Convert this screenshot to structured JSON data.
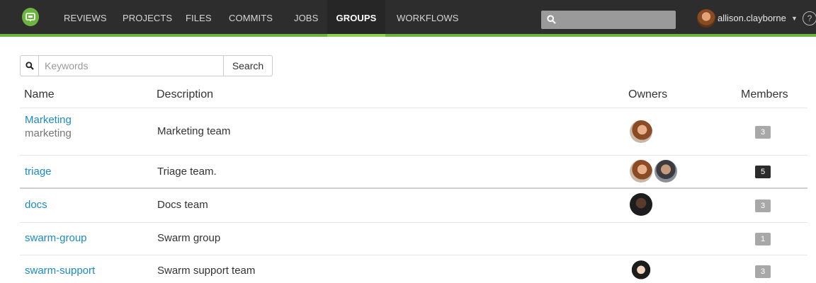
{
  "nav": {
    "items": [
      {
        "label": "REVIEWS",
        "active": false
      },
      {
        "label": "PROJECTS",
        "active": false
      },
      {
        "label": "FILES",
        "active": false
      },
      {
        "label": "COMMITS",
        "active": false
      },
      {
        "label": "JOBS",
        "active": false
      },
      {
        "label": "GROUPS",
        "active": true
      },
      {
        "label": "WORKFLOWS",
        "active": false
      }
    ],
    "user": "allison.clayborne",
    "help": "?"
  },
  "search": {
    "placeholder": "Keywords",
    "button_label": "Search"
  },
  "table": {
    "headers": {
      "name": "Name",
      "description": "Description",
      "owners": "Owners",
      "members": "Members"
    },
    "rows": [
      {
        "name": "Marketing",
        "id": "marketing",
        "description": "Marketing team",
        "owners": [
          "allison"
        ],
        "members": "3",
        "highlight": false
      },
      {
        "name": "triage",
        "id": "",
        "description": "Triage team.",
        "owners": [
          "allison",
          "man"
        ],
        "members": "5",
        "highlight": true
      },
      {
        "name": "docs",
        "id": "",
        "description": "Docs team",
        "owners": [
          "dark"
        ],
        "members": "3",
        "highlight": false
      },
      {
        "name": "swarm-group",
        "id": "",
        "description": "Swarm group",
        "owners": [],
        "members": "1",
        "highlight": false
      },
      {
        "name": "swarm-support",
        "id": "",
        "description": "Swarm support team",
        "owners": [
          "woman2"
        ],
        "members": "3",
        "highlight": false
      }
    ]
  },
  "colors": {
    "nav_bg": "#2d2d2d",
    "accent": "#6cb33f",
    "link": "#1d8ac7",
    "badge": "#a8a8a8",
    "badge_active": "#2b2b2b"
  }
}
